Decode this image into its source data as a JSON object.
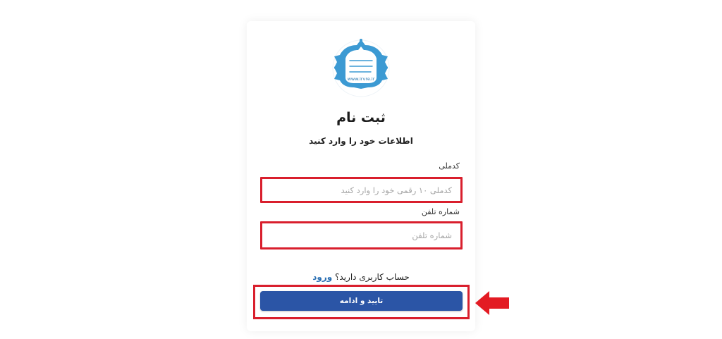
{
  "form": {
    "title": "ثبت نام",
    "subtitle": "اطلاعات خود را وارد کنید",
    "national_id_label": "کدملی",
    "national_id_placeholder": "کدملی ۱۰ رقمی خود را وارد کنید",
    "national_id_value": "",
    "phone_label": "شماره تلفن",
    "phone_placeholder": "شماره تلفن",
    "phone_value": "",
    "have_account_text": "حساب کاربری دارید؟",
    "login_link": "ورود",
    "submit_label": "تایید و ادامه"
  },
  "logo": {
    "line1": "انجمن علمی ...",
    "line2": "...",
    "url": "www.irvre.ir"
  },
  "colors": {
    "highlight": "#d91f2d",
    "primary": "#2b55a6",
    "link": "#2a6fb3",
    "logo_blue": "#3c9ad3"
  },
  "icons": {
    "annotation_arrow": "arrow-left-icon"
  }
}
